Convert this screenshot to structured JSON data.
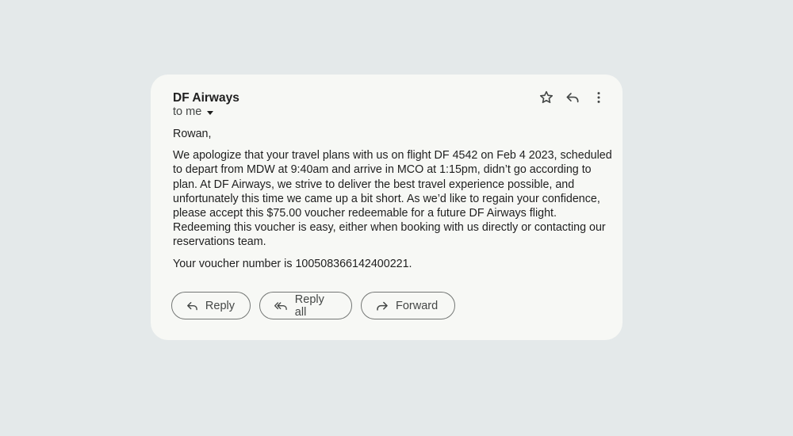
{
  "email": {
    "sender": "DF Airways",
    "recipient": "to me",
    "greeting": "Rowan,",
    "paragraph": "We apologize that your travel plans with us on flight DF 4542 on Feb 4 2023, scheduled to depart from MDW at 9:40am and arrive in MCO at 1:15pm, didn’t go according to plan. At DF Airways, we strive to deliver the best travel experience possible, and unfortunately this time we came up a bit short. As we’d like to regain your confidence, please accept this $75.00 voucher redeemable for a future DF Airways flight. Redeeming this voucher is easy, either when booking with us directly or contacting our reservations team.",
    "voucher_line": "Your voucher number is 100508366142400221."
  },
  "header_actions": {
    "icons": [
      "star-icon",
      "reply-icon",
      "more-vert-icon"
    ]
  },
  "buttons": {
    "reply_label": "Reply",
    "reply_all_label": "Reply all",
    "forward_label": "Forward"
  },
  "colors": {
    "background": "#e4e9ea",
    "card": "#f7f8f5",
    "text": "#1f1f1f",
    "secondary_text": "#444746",
    "outline": "#747775"
  }
}
